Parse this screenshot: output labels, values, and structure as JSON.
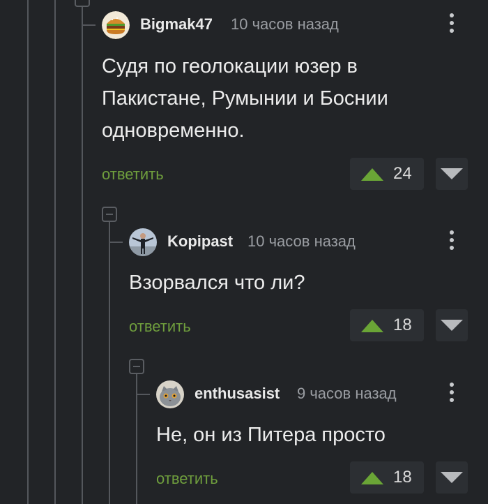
{
  "comments": [
    {
      "author": "Bigmak47",
      "time": "10 часов назад",
      "text_lines": [
        "Судя по геолокации юзер в",
        "Пакистане, Румынии и Боснии",
        "одновременно."
      ],
      "reply_label": "ответить",
      "score": "24",
      "avatar_icon": "burger-icon"
    },
    {
      "author": "Kopipast",
      "time": "10 часов назад",
      "text_lines": [
        "Взорвался что ли?"
      ],
      "reply_label": "ответить",
      "score": "18",
      "avatar_icon": "person-photo-icon"
    },
    {
      "author": "enthusasist",
      "time": "9 часов назад",
      "text_lines": [
        "Не, он из Питера просто"
      ],
      "reply_label": "ответить",
      "score": "18",
      "avatar_icon": "cat-photo-icon"
    }
  ],
  "colors": {
    "background": "#222427",
    "reply_link": "#6f9e3d",
    "upvote": "#6aa536",
    "thread_line": "#54575c"
  }
}
